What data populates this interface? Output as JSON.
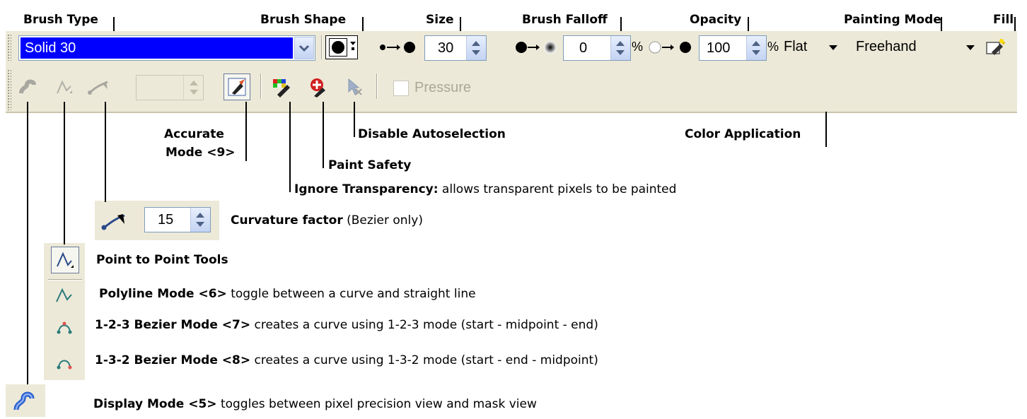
{
  "labels": {
    "brush_type": "Brush Type",
    "brush_shape": "Brush Shape",
    "size": "Size",
    "brush_falloff": "Brush Falloff",
    "opacity": "Opacity",
    "painting_mode": "Painting Mode",
    "fill": "Fill",
    "accurate_mode_1": "Accurate",
    "accurate_mode_2": "Mode <9>",
    "paint_safety": "Paint Safety",
    "disable_autoselection": "Disable Autoselection",
    "color_application": "Color Application",
    "ignore_transparency_bold": "Ignore Transparency:",
    "ignore_transparency_text": " allows transparent pixels to be painted",
    "curvature_bold": "Curvature factor",
    "curvature_text": " (Bezier only)",
    "p2p_bold": "Point to Point Tools",
    "polyline_bold": "Polyline Mode <6>",
    "polyline_text": " toggle between a curve and straight line",
    "bez123_bold": "1-2-3 Bezier Mode <7>",
    "bez123_text": " creates a curve using 1-2-3 mode (start - midpoint - end)",
    "bez132_bold": "1-3-2 Bezier Mode <8>",
    "bez132_text": " creates a curve using 1-3-2 mode (start - end - midpoint)",
    "display_bold": "Display Mode <5>",
    "display_text": " toggles between pixel precision view and mask view"
  },
  "toolbar": {
    "brush_type_value": "Solid 30",
    "size_value": "30",
    "falloff_value": "0",
    "falloff_unit": "%",
    "opacity_value": "100",
    "opacity_unit": "%",
    "color_application_value": "Flat",
    "painting_mode_value": "Freehand",
    "pressure_label": "Pressure",
    "curvature_value": "15"
  },
  "colors": {
    "toolbar_bg": "#ece9d8",
    "brush_type_highlight": "#0000ff"
  }
}
